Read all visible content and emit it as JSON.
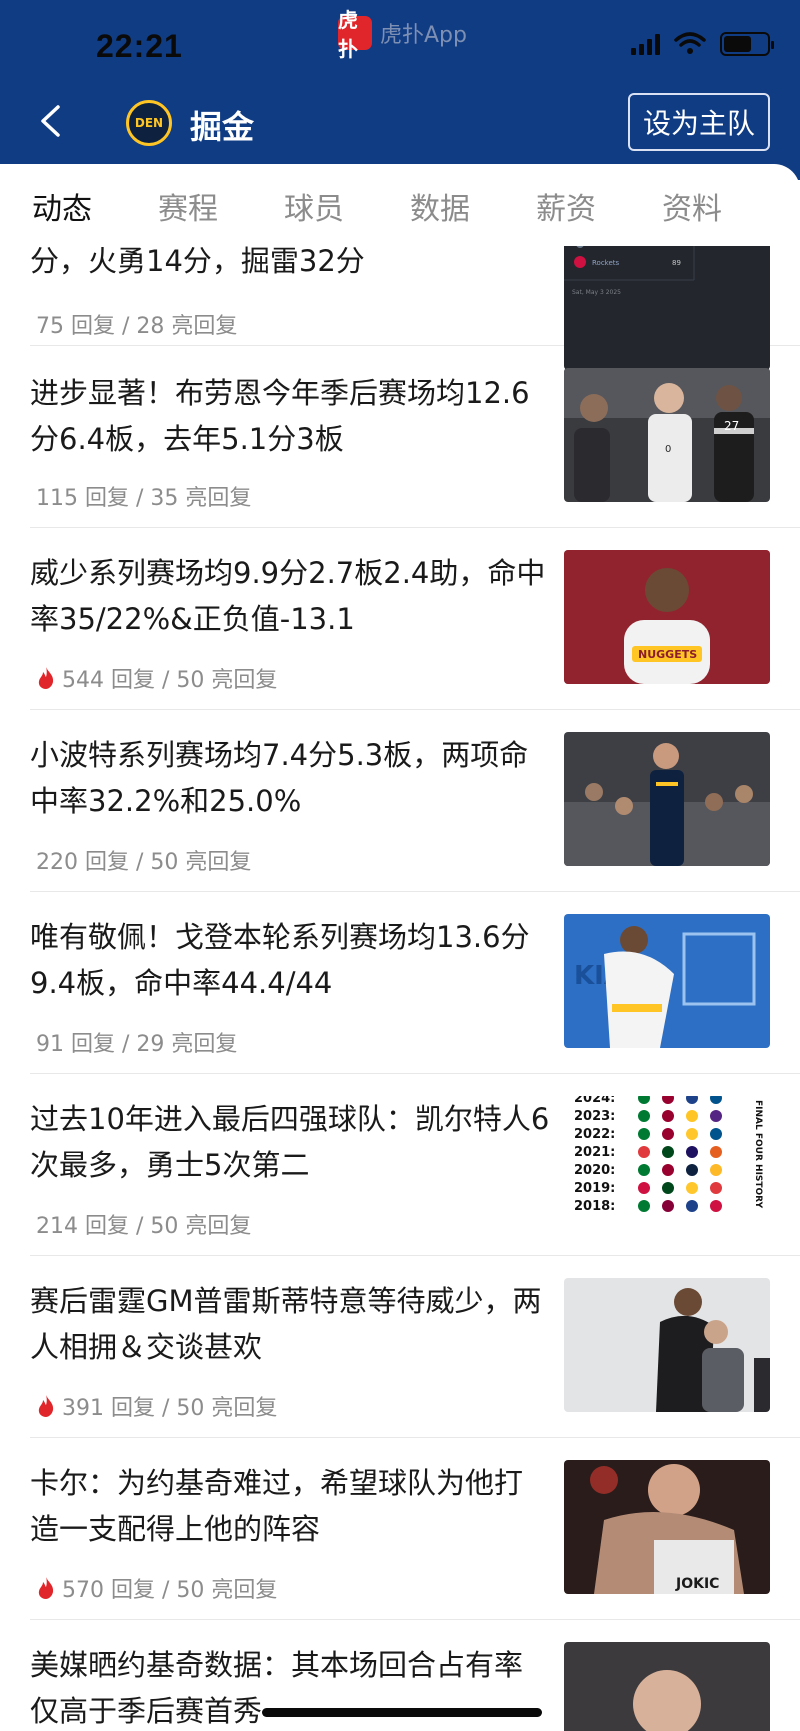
{
  "status_bar": {
    "time": "22:21",
    "app_logo_text": "虎扑",
    "app_name": "虎扑App",
    "battery_level": 0.65
  },
  "header": {
    "team_logo": "DEN",
    "team_name": "掘金",
    "set_home_button": "设为主队"
  },
  "tabs": [
    {
      "label": "动态",
      "active": true
    },
    {
      "label": "赛程",
      "active": false
    },
    {
      "label": "球员",
      "active": false
    },
    {
      "label": "数据",
      "active": false
    },
    {
      "label": "薪资",
      "active": false
    },
    {
      "label": "资料",
      "active": false
    }
  ],
  "feed": [
    {
      "title": "分，火勇14分，掘雷32分",
      "meta": "75 回复 / 28 亮回复",
      "hot": false,
      "thumb_texts": [
        "Rockets",
        "89",
        "Sat, May 3 2025"
      ]
    },
    {
      "title": "进步显著！布劳恩今年季后赛场均12.6分6.4板，去年5.1分3板",
      "meta": "115 回复 / 35 亮回复",
      "hot": false,
      "thumb_texts": [
        "0",
        "27"
      ]
    },
    {
      "title": "威少系列赛场均9.9分2.7板2.4助，命中率35/22%&正负值-13.1",
      "meta": "544 回复 / 50 亮回复",
      "hot": true,
      "thumb_texts": [
        "NUGGETS"
      ]
    },
    {
      "title": "小波特系列赛场均7.4分5.3板，两项命中率32.2%和25.0%",
      "meta": "220 回复 / 50 亮回复",
      "hot": false,
      "thumb_texts": []
    },
    {
      "title": "唯有敬佩！戈登本轮系列赛场均13.6分9.4板，命中率44.4/44",
      "meta": "91 回复 / 29 亮回复",
      "hot": false,
      "thumb_texts": [
        "KIA"
      ]
    },
    {
      "title": "过去10年进入最后四强球队：凯尔特人6次最多，勇士5次第二",
      "meta": "214 回复 / 50 亮回复",
      "hot": false,
      "thumb_texts": [
        "2024:",
        "2023:",
        "2022:",
        "2021:",
        "2020:",
        "2019:",
        "2018:",
        "FINAL FOUR HISTORY"
      ]
    },
    {
      "title": "赛后雷霆GM普雷斯蒂特意等待威少，两人相拥＆交谈甚欢",
      "meta": "391 回复 / 50 亮回复",
      "hot": true,
      "thumb_texts": []
    },
    {
      "title": "卡尔：为约基奇难过，希望球队为他打造一支配得上他的阵容",
      "meta": "570 回复 / 50 亮回复",
      "hot": true,
      "thumb_texts": [
        "JOKIC"
      ]
    },
    {
      "title": "美媒晒约基奇数据：其本场回合占有率仅高于季后赛首秀",
      "meta": "",
      "hot": false,
      "thumb_texts": []
    }
  ],
  "colors": {
    "header_bg": "#103c84",
    "accent_red": "#e0262b",
    "meta_gray": "#8c8c8c"
  }
}
